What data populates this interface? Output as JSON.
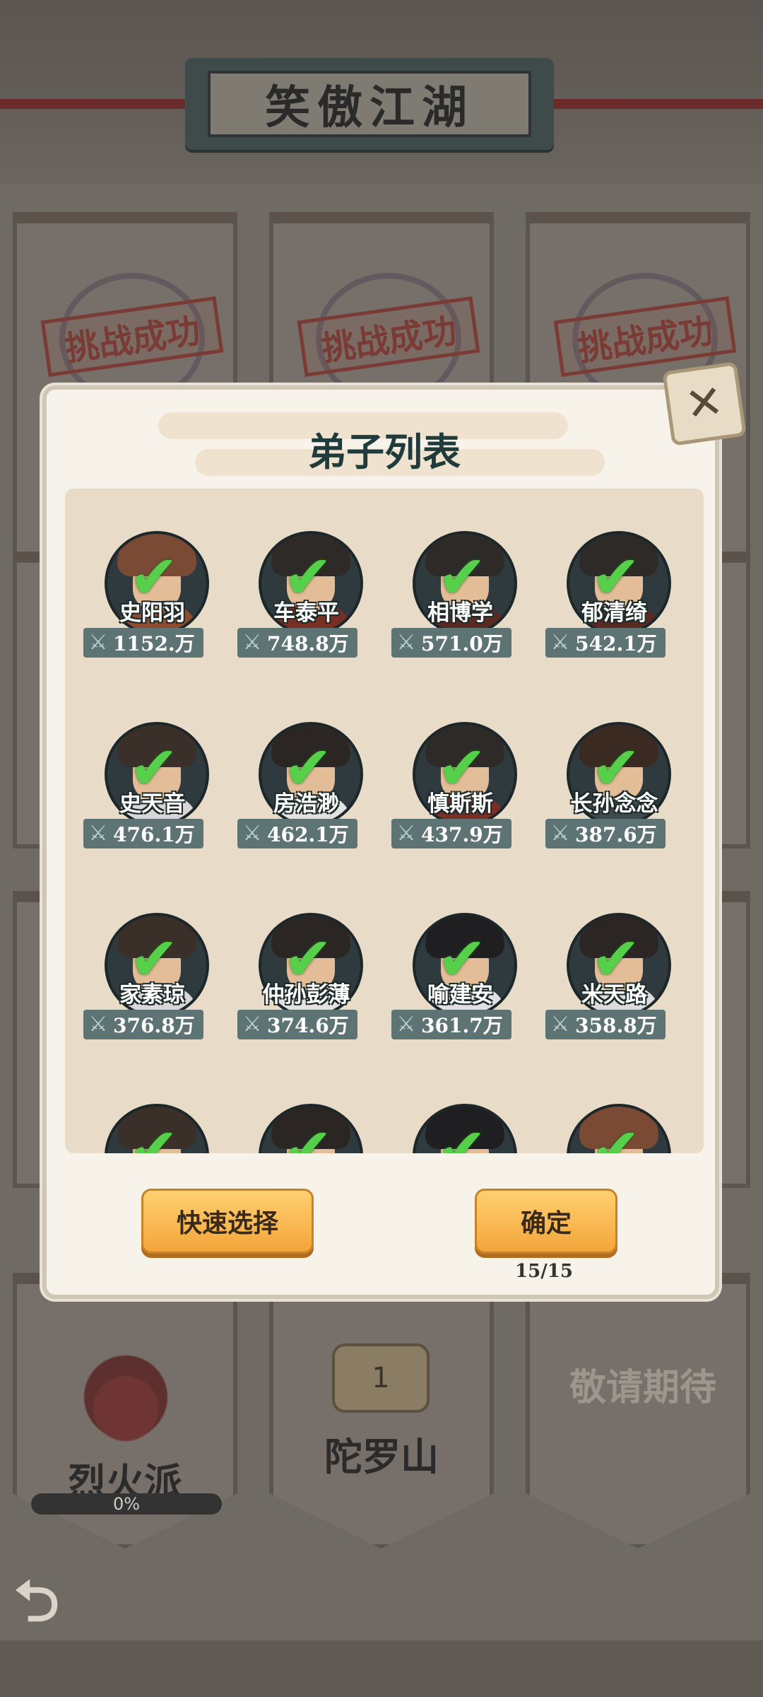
{
  "header": {
    "title": "笑傲江湖"
  },
  "stages": {
    "top_row": [
      {
        "stamp": "挑战成功"
      },
      {
        "stamp": "挑战成功"
      },
      {
        "stamp": "挑战成功"
      }
    ],
    "bottom_row": [
      {
        "label": "烈火派",
        "progress": "0%"
      },
      {
        "label": "陀罗山",
        "lock_number": "1"
      },
      {
        "label": "敬请期待"
      }
    ]
  },
  "modal": {
    "title": "弟子列表",
    "close_icon": "close-icon",
    "disciples": [
      {
        "name": "史阳羽",
        "power": "1152.万",
        "hair": "#7a4a35",
        "robe": "#8e4b2d"
      },
      {
        "name": "车泰平",
        "power": "748.8万",
        "hair": "#2e2a28",
        "robe": "#7a2f24"
      },
      {
        "name": "相博学",
        "power": "571.0万",
        "hair": "#2e2a28",
        "robe": "#5a2a22"
      },
      {
        "name": "郁清绮",
        "power": "542.1万",
        "hair": "#2e2a28",
        "robe": "#5a2a22"
      },
      {
        "name": "史天音",
        "power": "476.1万",
        "hair": "#3b2f2a",
        "robe": "#d8d6d8"
      },
      {
        "name": "房浩渺",
        "power": "462.1万",
        "hair": "#2b2624",
        "robe": "#e4e2e0"
      },
      {
        "name": "慎斯斯",
        "power": "437.9万",
        "hair": "#2e2a28",
        "robe": "#7a2f24"
      },
      {
        "name": "长孙念念",
        "power": "387.6万",
        "hair": "#3a2a22",
        "robe": "#3e4a4a"
      },
      {
        "name": "家素琼",
        "power": "376.8万",
        "hair": "#3b2f2a",
        "robe": "#d8d6d8"
      },
      {
        "name": "仲孙彭薄",
        "power": "374.6万",
        "hair": "#2b2624",
        "robe": "#e4e2e0"
      },
      {
        "name": "喻建安",
        "power": "361.7万",
        "hair": "#1f1f22",
        "robe": "#e0e0e4"
      },
      {
        "name": "米天路",
        "power": "358.8万",
        "hair": "#2b2624",
        "robe": "#dcdcdc"
      },
      {
        "name": "",
        "power": "",
        "hair": "#3b2f2a",
        "robe": "#d8d6d8"
      },
      {
        "name": "",
        "power": "",
        "hair": "#2b2624",
        "robe": "#e4e2e0"
      },
      {
        "name": "",
        "power": "",
        "hair": "#1f1f22",
        "robe": "#e0e0e4"
      },
      {
        "name": "",
        "power": "",
        "hair": "#7a4a35",
        "robe": "#8e4b2d"
      }
    ],
    "quick_select_label": "快速选择",
    "confirm_label": "确定",
    "count": "15/15"
  },
  "colors": {
    "accent": "#f3a53a",
    "check": "#56d04a",
    "panel": "#f7f3ea"
  }
}
